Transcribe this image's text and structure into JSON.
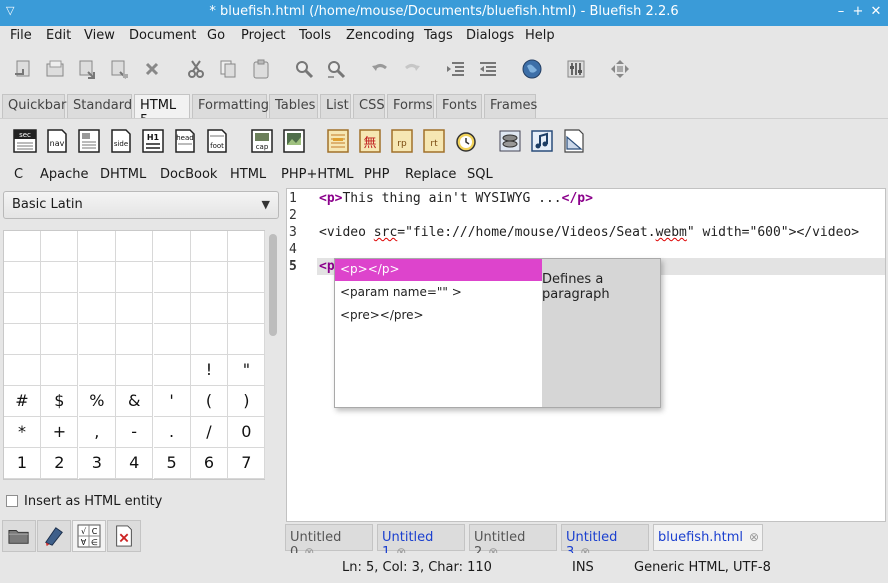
{
  "window": {
    "title": "* bluefish.html (/home/mouse/Documents/bluefish.html) - Bluefish 2.2.6",
    "menu_glyph": "▽",
    "minimize_glyph": "–",
    "maximize_glyph": "+",
    "close_glyph": "✕"
  },
  "menubar": [
    "File",
    "Edit",
    "View",
    "Document",
    "Go",
    "Project",
    "Tools",
    "Zencoding",
    "Tags",
    "Dialogs",
    "Help"
  ],
  "main_toolbar_icons": [
    "new-file-icon",
    "open-icon",
    "save-icon",
    "save-as-icon",
    "close-icon",
    "cut-icon",
    "copy-icon",
    "paste-icon",
    "find-icon",
    "replace-icon",
    "undo-icon",
    "redo-icon",
    "indent-icon",
    "unindent-icon",
    "browser-preview-icon",
    "preferences-icon",
    "fullscreen-icon"
  ],
  "toolbar_tabs": [
    "Quickbar",
    "Standard",
    "HTML 5",
    "Formatting",
    "Tables",
    "List",
    "CSS",
    "Forms",
    "Fonts",
    "Frames"
  ],
  "active_toolbar_tab": "HTML 5",
  "html5_buttons": [
    {
      "name": "section-icon",
      "label": "sec"
    },
    {
      "name": "nav-icon",
      "label": "nav"
    },
    {
      "name": "article-icon",
      "label": ""
    },
    {
      "name": "aside-icon",
      "label": "side"
    },
    {
      "name": "hgroup-icon",
      "label": "H1"
    },
    {
      "name": "header-icon",
      "label": "head"
    },
    {
      "name": "footer-icon",
      "label": "foot"
    },
    {
      "name": "figcaption-icon",
      "label": "cap"
    },
    {
      "name": "figure-icon",
      "label": ""
    },
    {
      "name": "mark-icon",
      "label": ""
    },
    {
      "name": "ruby-icon",
      "label": "無"
    },
    {
      "name": "rp-icon",
      "label": "rp"
    },
    {
      "name": "rt-icon",
      "label": "rt"
    },
    {
      "name": "time-icon",
      "label": ""
    },
    {
      "name": "video-icon",
      "label": ""
    },
    {
      "name": "audio-icon",
      "label": ""
    },
    {
      "name": "canvas-icon",
      "label": ""
    }
  ],
  "language_menu": [
    "C",
    "Apache",
    "DHTML",
    "DocBook",
    "HTML",
    "PHP+HTML",
    "PHP",
    "Replace",
    "SQL"
  ],
  "charmap": {
    "block": "Basic Latin",
    "rows": [
      [
        "",
        "",
        "",
        "",
        "",
        "",
        ""
      ],
      [
        "",
        "",
        "",
        "",
        "",
        "",
        ""
      ],
      [
        "",
        "",
        "",
        "",
        "",
        "",
        ""
      ],
      [
        "",
        "",
        "",
        "",
        "",
        "",
        ""
      ],
      [
        "",
        "",
        "",
        "",
        "",
        "!",
        "\""
      ],
      [
        "#",
        "$",
        "%",
        "&",
        "'",
        "(",
        ")"
      ],
      [
        "*",
        "+",
        ",",
        "-",
        ".",
        "/",
        "0"
      ],
      [
        "1",
        "2",
        "3",
        "4",
        "5",
        "6",
        "7"
      ]
    ],
    "insert_entity_label": "Insert as HTML entity",
    "insert_entity_checked": false
  },
  "side_tabs": [
    "file-browser-icon",
    "bookmarks-icon",
    "charmap-icon",
    "snippets-icon"
  ],
  "editor": {
    "line_numbers": [
      "1",
      "2",
      "3",
      "4",
      "5"
    ],
    "current_line": 5,
    "line1": {
      "open": "<p>",
      "text": "This thing ain't WYSIWYG ...",
      "close": "</p>"
    },
    "line3": {
      "pre": "<video ",
      "attr1": "src",
      "mid": "=\"file:///home/mouse/Videos/Seat.",
      "ext": "webm",
      "post": "\" width=\"600\"></video>"
    },
    "line5": "<p"
  },
  "autocomplete": {
    "items": [
      "<p></p>",
      "<param name=\"\" >",
      "<pre></pre>"
    ],
    "selected_index": 0,
    "description": "Defines a paragraph"
  },
  "document_tabs": [
    {
      "label": "Untitled 0",
      "color": "#555555"
    },
    {
      "label": "Untitled 1",
      "color": "#1a3fcf"
    },
    {
      "label": "Untitled 2",
      "color": "#555555"
    },
    {
      "label": "Untitled 3",
      "color": "#1a3fcf"
    },
    {
      "label": "bluefish.html",
      "color": "#1a3fcf"
    }
  ],
  "active_document": "bluefish.html",
  "statusbar": {
    "position": "Ln: 5, Col: 3, Char: 110",
    "mode": "INS",
    "encoding": "Generic HTML, UTF-8"
  }
}
